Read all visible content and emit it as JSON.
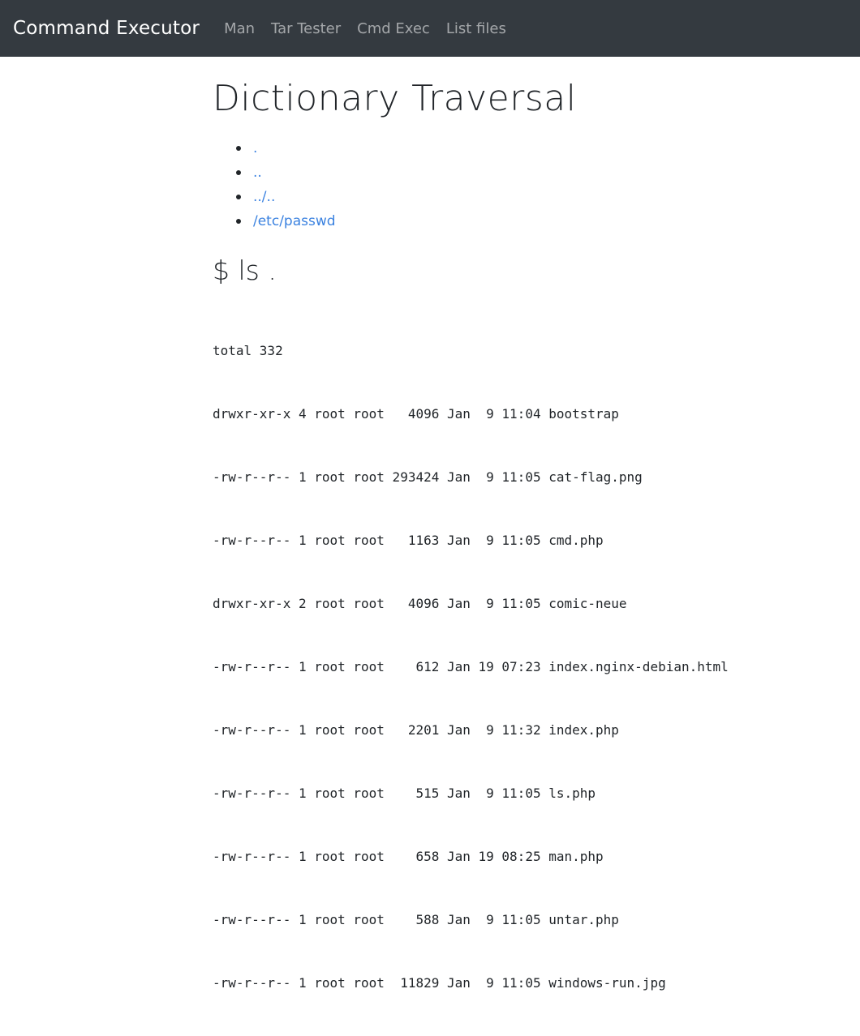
{
  "navbar": {
    "brand": "Command Executor",
    "links": [
      "Man",
      "Tar Tester",
      "Cmd Exec",
      "List files"
    ]
  },
  "main": {
    "title": "Dictionary Traversal",
    "directories": [
      ".",
      "..",
      "../..",
      "/etc/passwd"
    ],
    "command_heading": "$ ls .",
    "output_lines": [
      "total 332",
      "drwxr-xr-x 4 root root   4096 Jan  9 11:04 bootstrap",
      "-rw-r--r-- 1 root root 293424 Jan  9 11:05 cat-flag.png",
      "-rw-r--r-- 1 root root   1163 Jan  9 11:05 cmd.php",
      "drwxr-xr-x 2 root root   4096 Jan  9 11:05 comic-neue",
      "-rw-r--r-- 1 root root    612 Jan 19 07:23 index.nginx-debian.html",
      "-rw-r--r-- 1 root root   2201 Jan  9 11:32 index.php",
      "-rw-r--r-- 1 root root    515 Jan  9 11:05 ls.php",
      "-rw-r--r-- 1 root root    658 Jan 19 08:25 man.php",
      "-rw-r--r-- 1 root root    588 Jan  9 11:05 untar.php",
      "-rw-r--r-- 1 root root  11829 Jan  9 11:05 windows-run.jpg"
    ]
  },
  "colors": {
    "navbar_bg": "#343a40",
    "link": "#3b82e0"
  }
}
